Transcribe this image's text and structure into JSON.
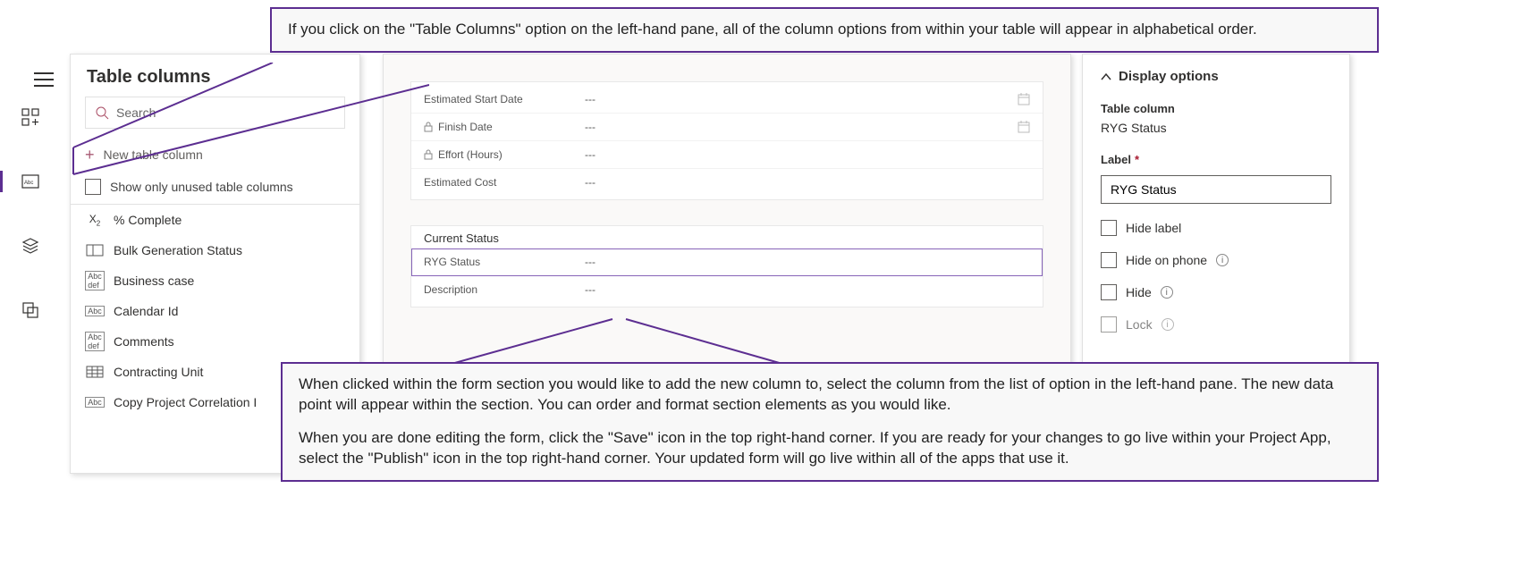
{
  "callouts": {
    "top": "If you click on the \"Table Columns\" option on the left-hand pane, all of the column options from within your table will appear in alphabetical order.",
    "bottom_p1": "When clicked within the form section you would like to add the new column to, select the column from the list of option in the left-hand pane. The new data point will appear within the section. You can order and format section elements as you would like.",
    "bottom_p2": "When you are done editing the form, click the \"Save\" icon in the top right-hand corner. If you are ready for your changes to go live within your Project App, select the \"Publish\" icon in the top right-hand corner. Your updated form will go live within all of the apps that use it."
  },
  "leftPane": {
    "title": "Table columns",
    "searchPlaceholder": "Search",
    "newColumn": "New table column",
    "showOnly": "Show only unused table columns",
    "items": [
      {
        "icon": "x2",
        "label": "% Complete"
      },
      {
        "icon": "rect",
        "label": "Bulk Generation Status"
      },
      {
        "icon": "abcdef",
        "label": "Business case"
      },
      {
        "icon": "abc",
        "label": "Calendar Id"
      },
      {
        "icon": "abcdef",
        "label": "Comments"
      },
      {
        "icon": "grid",
        "label": "Contracting Unit"
      },
      {
        "icon": "abc",
        "label": "Copy Project Correlation I"
      }
    ]
  },
  "form": {
    "top_fields": [
      {
        "label": "Estimated Start Date",
        "value": "---",
        "locked": false,
        "cal": true
      },
      {
        "label": "Finish Date",
        "value": "---",
        "locked": true,
        "cal": true
      },
      {
        "label": "Effort (Hours)",
        "value": "---",
        "locked": true,
        "cal": false
      },
      {
        "label": "Estimated Cost",
        "value": "---",
        "locked": false,
        "cal": false
      }
    ],
    "section_title": "Current Status",
    "section_fields": [
      {
        "label": "RYG Status",
        "value": "---",
        "selected": true
      },
      {
        "label": "Description",
        "value": "---",
        "selected": false
      }
    ]
  },
  "rightPane": {
    "header": "Display options",
    "tableColumnLabel": "Table column",
    "tableColumnValue": "RYG Status",
    "labelFieldLabel": "Label",
    "labelFieldValue": "RYG Status",
    "hideLabel": "Hide label",
    "hideOnPhone": "Hide on phone",
    "hide": "Hide",
    "lock": "Lock"
  }
}
